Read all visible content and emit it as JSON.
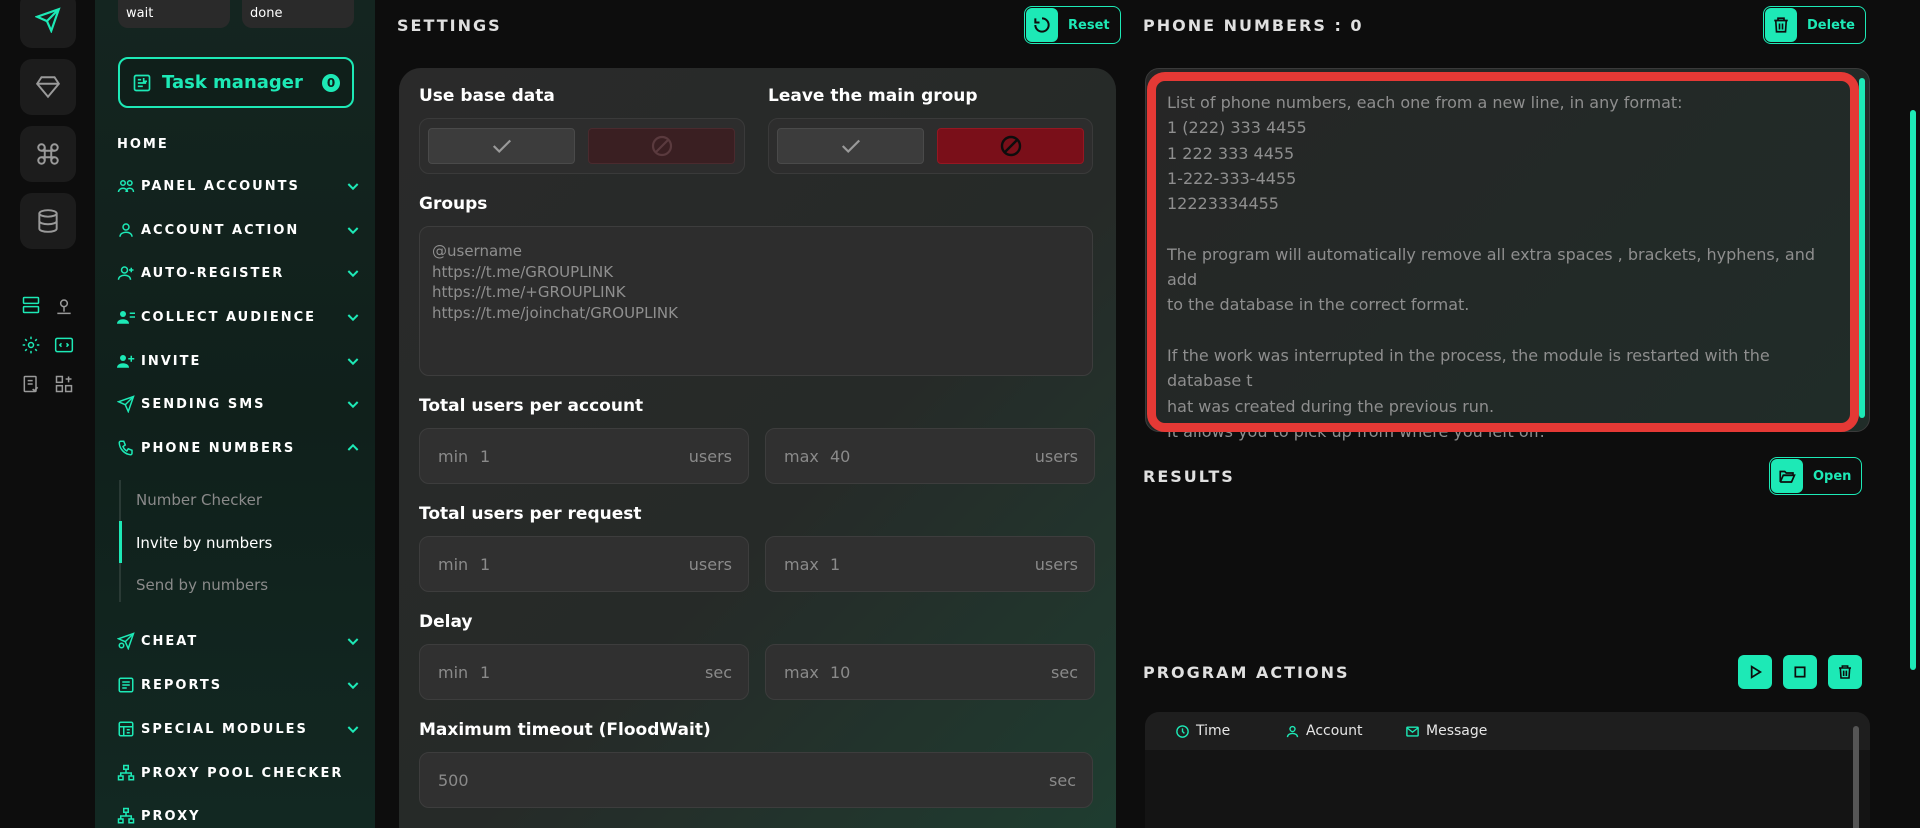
{
  "colors": {
    "accent": "#1de9b6",
    "danger": "#e53935",
    "reject": "#7a0f19"
  },
  "sidebar": {
    "status_chips": [
      "wait",
      "done"
    ],
    "task_manager": {
      "label": "Task manager",
      "count": "0"
    },
    "home": "HOME",
    "items": [
      {
        "label": "PANEL ACCOUNTS",
        "icon": "users-icon"
      },
      {
        "label": "ACCOUNT ACTION",
        "icon": "user-icon"
      },
      {
        "label": "AUTO-REGISTER",
        "icon": "user-plus-icon"
      },
      {
        "label": "COLLECT AUDIENCE",
        "icon": "user-list-icon"
      },
      {
        "label": "INVITE",
        "icon": "user-add-icon"
      },
      {
        "label": "SENDING SMS",
        "icon": "send-icon"
      },
      {
        "label": "PHONE NUMBERS",
        "icon": "phone-icon"
      },
      {
        "label": "CHEAT",
        "icon": "cheat-icon"
      },
      {
        "label": "REPORTS",
        "icon": "report-icon"
      },
      {
        "label": "SPECIAL MODULES",
        "icon": "modules-icon"
      },
      {
        "label": "PROXY POOL CHECKER",
        "icon": "network-icon"
      },
      {
        "label": "PROXY",
        "icon": "network-icon"
      }
    ],
    "phone_sub": [
      "Number Checker",
      "Invite by numbers",
      "Send by numbers"
    ]
  },
  "settings": {
    "title": "SETTINGS",
    "reset_label": "Reset",
    "use_base_data": "Use base data",
    "leave_main_group": "Leave the main group",
    "groups_label": "Groups",
    "groups_placeholder": "@username\nhttps://t.me/GROUPLINK\nhttps://t.me/+GROUPLINK\nhttps://t.me/joinchat/GROUPLINK",
    "total_per_account": {
      "label": "Total users per account",
      "min": "1",
      "max": "40",
      "unit": "users"
    },
    "total_per_request": {
      "label": "Total users per request",
      "min": "1",
      "max": "1",
      "unit": "users"
    },
    "delay": {
      "label": "Delay",
      "min": "1",
      "max": "10",
      "unit": "sec"
    },
    "floodwait": {
      "label": "Maximum timeout (FloodWait)",
      "value": "500",
      "unit": "sec"
    },
    "min_label": "min",
    "max_label": "max"
  },
  "phones": {
    "title": "PHONE NUMBERS : 0",
    "delete_label": "Delete",
    "placeholder": "List of phone numbers, each one from a new line, in any format:\n1 (222) 333 4455\n1 222 333 4455\n1-222-333-4455\n12223334455\n\n The program will automatically remove all extra spaces , brackets, hyphens, and add\nto the database in the correct format.\n\nIf the work was interrupted in the process, the module is restarted with the database t\nhat was created during the previous run.\nIt allows you to pick up from where you left off."
  },
  "results": {
    "title": "RESULTS",
    "open_label": "Open"
  },
  "actions": {
    "title": "PROGRAM ACTIONS",
    "columns": [
      "Time",
      "Account",
      "Message"
    ]
  }
}
